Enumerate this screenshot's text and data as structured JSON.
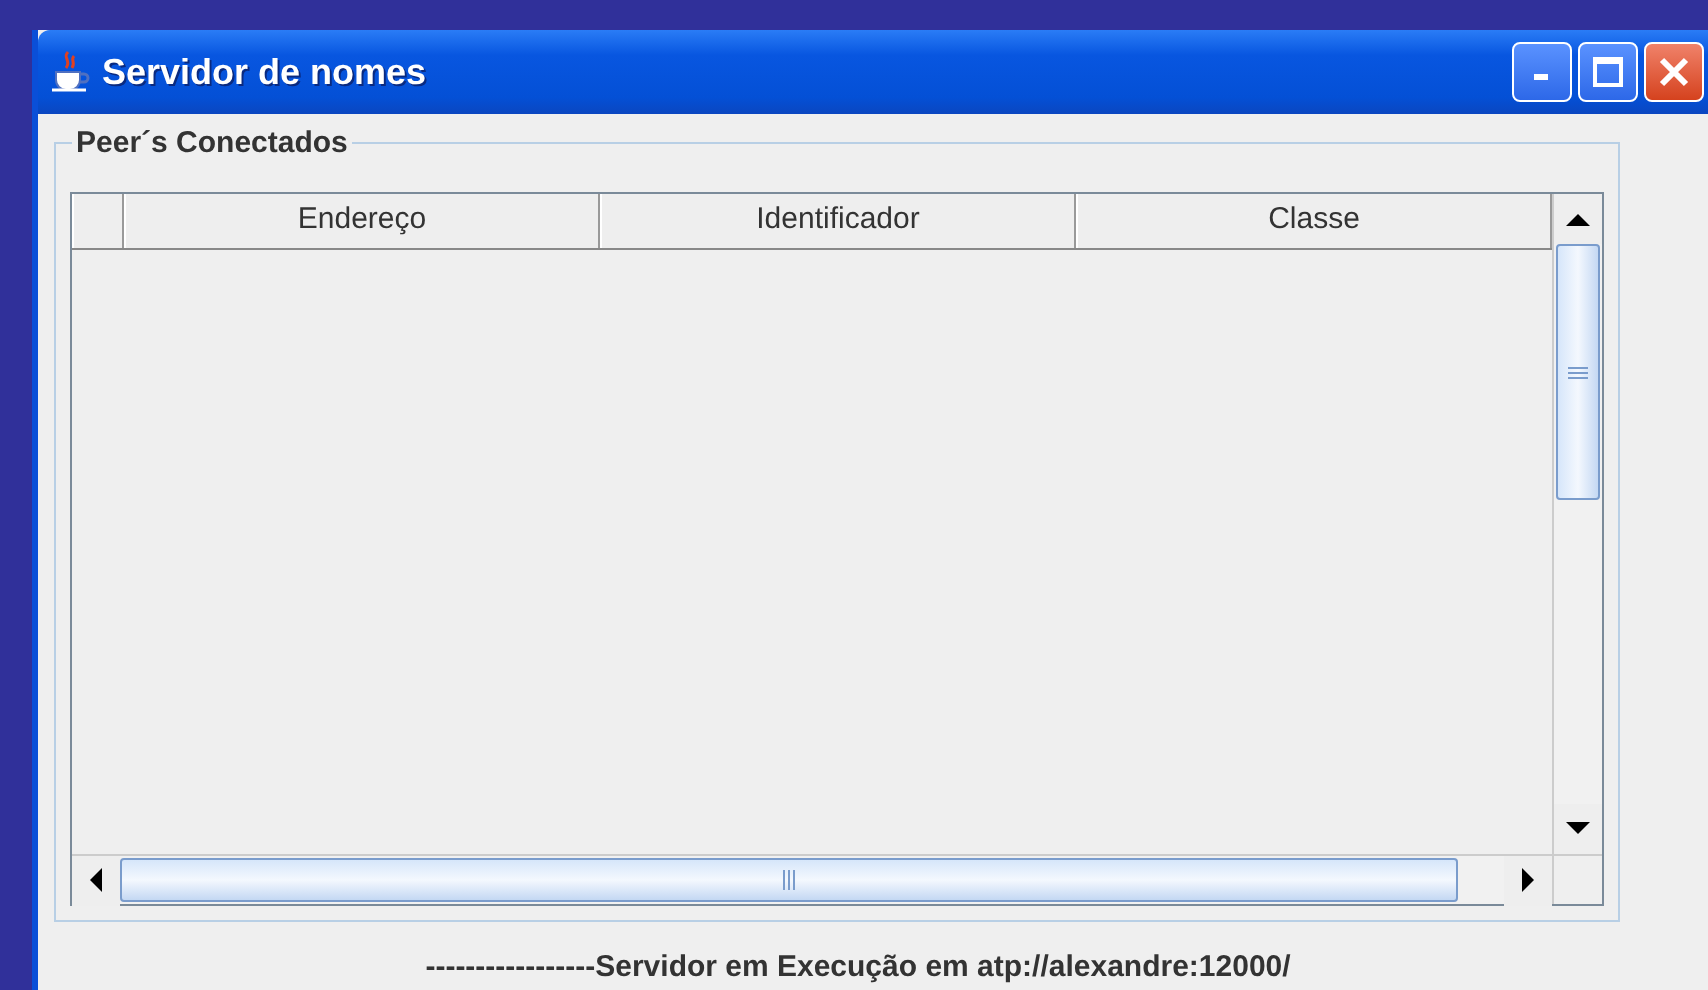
{
  "window": {
    "title": "Servidor de nomes"
  },
  "panel": {
    "title": "Peer´s Conectados"
  },
  "table": {
    "columns": [
      "Endereço",
      "Identificador",
      "Classe"
    ]
  },
  "status_bar": {
    "text": "-----------------Servidor em Execução em atp://alexandre:12000/"
  }
}
